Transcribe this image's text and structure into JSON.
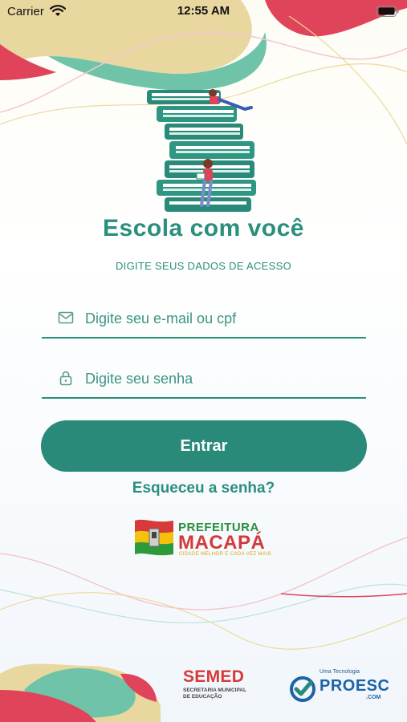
{
  "status_bar": {
    "carrier": "Carrier",
    "time": "12:55 AM",
    "wifi_icon": "wifi-icon",
    "battery_icon": "battery-icon"
  },
  "app": {
    "title": "Escola com você",
    "subtitle": "DIGITE SEUS DADOS DE ACESSO",
    "illustration": "books-stack-readers-illustration"
  },
  "form": {
    "email": {
      "placeholder": "Digite seu e-mail ou cpf",
      "value": "",
      "icon": "envelope-icon"
    },
    "password": {
      "placeholder": "Digite seu senha",
      "value": "",
      "icon": "lock-icon"
    },
    "submit_label": "Entrar",
    "forgot_label": "Esqueceu a senha?"
  },
  "footer": {
    "prefeitura": {
      "line1": "PREFEITURA",
      "line2": "MACAPÁ",
      "line3": "CIDADE MELHOR E CADA VEZ MAIS"
    },
    "semed": {
      "title": "SEMED",
      "subtitle_line1": "SECRETARIA MUNICIPAL",
      "subtitle_line2": "DE EDUCAÇÃO"
    },
    "proesc": {
      "tagline": "Uma Tecnologia",
      "name": "PROESC",
      "suffix": ".COM"
    }
  },
  "colors": {
    "primary": "#2a8a79",
    "accent_red": "#e0445a",
    "accent_yellow": "#e9d7a0",
    "accent_green": "#6fc3a9"
  }
}
